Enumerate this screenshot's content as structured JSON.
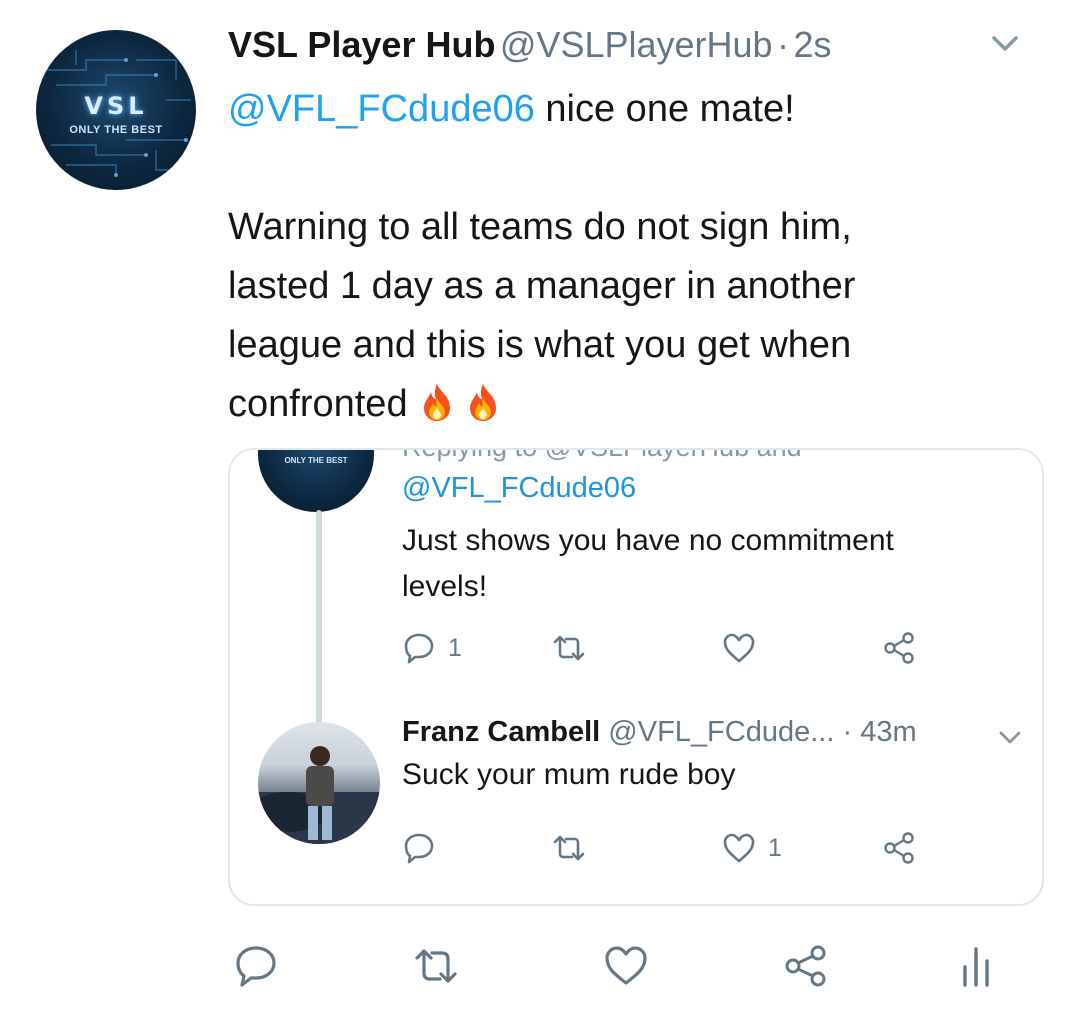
{
  "tweet": {
    "author_name": "VSL Player Hub",
    "author_handle": "@VSLPlayerHub",
    "separator": "·",
    "time": "2s",
    "avatar_logo": "VSL",
    "avatar_tagline": "ONLY THE BEST",
    "reply_mention": "@VFL_FCdude06",
    "reply_text": " nice one mate!",
    "body_lines": [
      "Warning to all teams do not sign him,",
      "lasted 1 day as a manager in another",
      "league and this is what you get when",
      "confronted"
    ],
    "emoji": [
      "fire-emoji",
      "fire-emoji"
    ]
  },
  "embedded": {
    "avatar_tagline": "ONLY THE BEST",
    "cut_text": "Replying to @VSLPlayerHub and",
    "first_reply": {
      "mention": "@VFL_FCdude06",
      "text_line1": "Just shows you have no commitment",
      "text_line2": "levels!",
      "reply_count": "1",
      "like_count": ""
    },
    "second_reply": {
      "name": "Franz Cambell",
      "handle": "@VFL_FCdude...",
      "separator": "·",
      "time": "43m",
      "text": "Suck your mum rude boy",
      "reply_count": "",
      "like_count": "1"
    }
  },
  "icons": {
    "reply": "reply-icon",
    "retweet": "retweet-icon",
    "like": "heart-icon",
    "share": "share-icon",
    "analytics": "analytics-icon",
    "menu": "chevron-down-icon"
  },
  "colors": {
    "link": "#1da1f2",
    "muted": "#657786",
    "border": "#e1e8ed",
    "text": "#14171a"
  }
}
